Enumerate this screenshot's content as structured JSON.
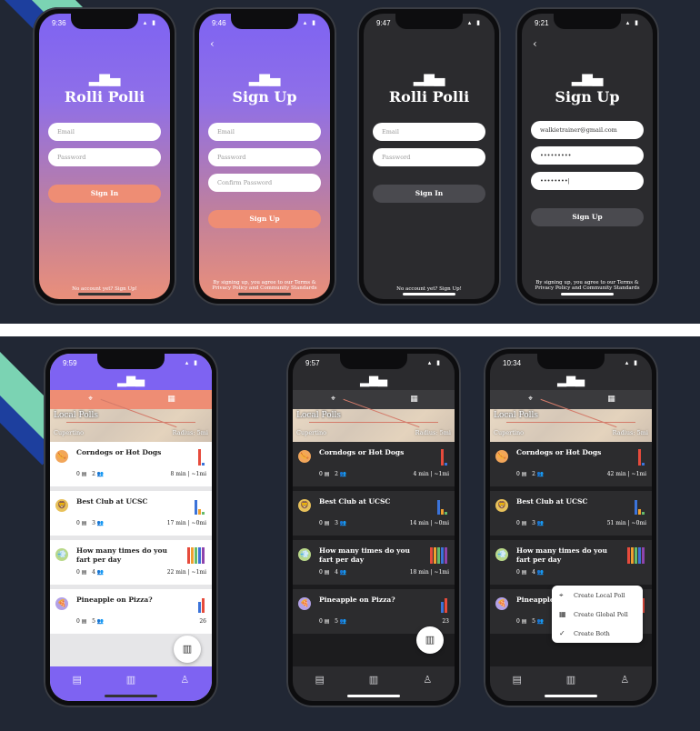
{
  "login_screens": [
    {
      "time": "9:36",
      "theme": "purple",
      "title": "Rolli Polli",
      "fields": [
        "Email",
        "Password"
      ],
      "button": "Sign In",
      "footer": "No account yet?  Sign Up!"
    },
    {
      "time": "9:46",
      "theme": "purple",
      "title": "Sign Up",
      "fields": [
        "Email",
        "Password",
        "Confirm Password"
      ],
      "button": "Sign Up",
      "footer": "By signing up, you agree to our Terms & Privacy Policy and Community Standards"
    },
    {
      "time": "9:47",
      "theme": "dark",
      "title": "Rolli Polli",
      "fields": [
        "Email",
        "Password"
      ],
      "button": "Sign In",
      "footer": "No account yet?  Sign Up!"
    },
    {
      "time": "9:21",
      "theme": "dark",
      "title": "Sign Up",
      "fields": [
        "walkietrainer@gmail.com",
        "•••••••••",
        "••••••••|"
      ],
      "button": "Sign Up",
      "footer": "By signing up, you agree to our Terms & Privacy Policy and Community Standards"
    }
  ],
  "app_screens": [
    {
      "time": "9:59",
      "theme": "light"
    },
    {
      "time": "9:57",
      "theme": "dark"
    },
    {
      "time": "10:34",
      "theme": "dark"
    }
  ],
  "map": {
    "title": "Local Polls",
    "left": "Cupertino",
    "right": "Radius: 5mi"
  },
  "polls": [
    {
      "question": "Corndogs or Hot Dogs",
      "comments": "0",
      "votes": "2",
      "dist_light": "8 min | ~1mi",
      "dist_dark1": "4 min | ~1mi",
      "dist_dark2": "42 min | ~1mi",
      "emoji": "🌭"
    },
    {
      "question": "Best Club at UCSC",
      "comments": "0",
      "votes": "3",
      "dist_light": "17 min | ~0mi",
      "dist_dark1": "14 min | ~0mi",
      "dist_dark2": "51 min | ~0mi",
      "emoji": "🦁"
    },
    {
      "question": "How many times do you fart per day",
      "comments": "0",
      "votes": "4",
      "dist_light": "22 min | ~1mi",
      "dist_dark1": "18 min | ~1mi",
      "dist_dark2": "",
      "emoji": "💨"
    },
    {
      "question": "Pineapple on Pizza?",
      "comments": "0",
      "votes": "5",
      "dist_light": "26",
      "dist_dark1": "23",
      "dist_dark2": "",
      "emoji": "🍕"
    }
  ],
  "create_menu": [
    "Create Local Poll",
    "Create Global Poll",
    "Create Both"
  ],
  "colors": {
    "purple": "#7e63f2",
    "salmon": "#ee8d74",
    "dark": "#2b2b2e",
    "navy": "#212734"
  },
  "icons": {
    "logo": "bar-chart-icon",
    "pin": "location-pin-icon",
    "map": "map-icon",
    "comment": "comment-icon",
    "people": "people-icon",
    "feed": "feed-icon",
    "polls": "polls-icon",
    "profile": "profile-icon"
  }
}
